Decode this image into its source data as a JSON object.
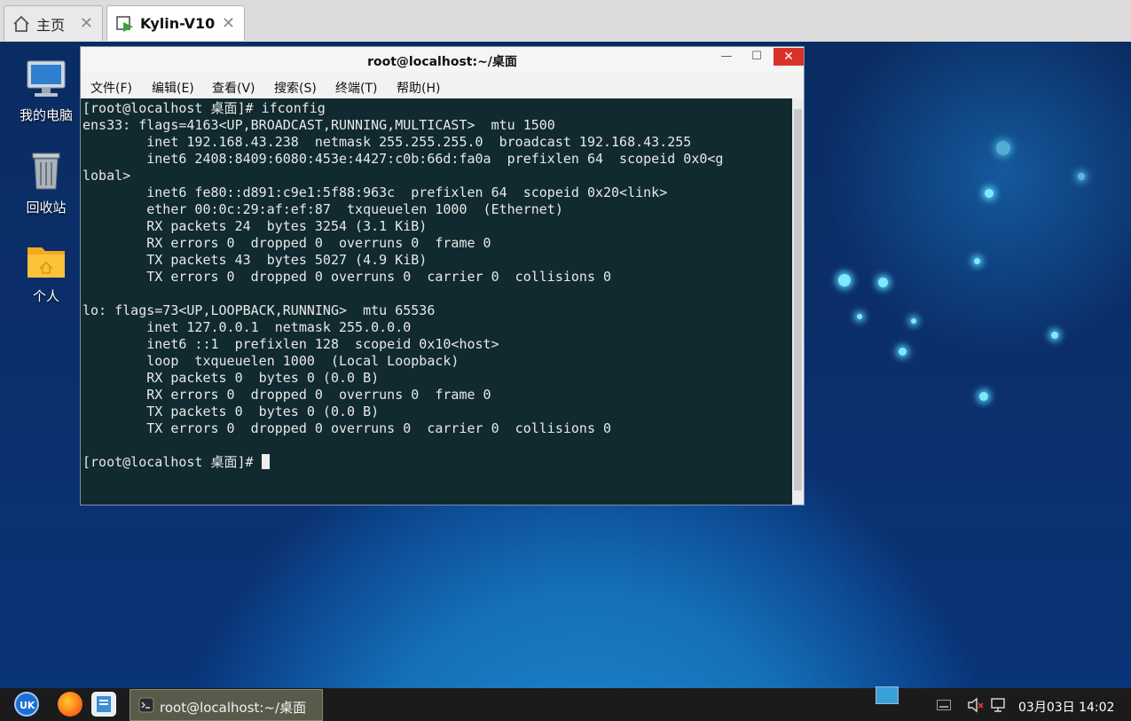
{
  "vm_tabs": [
    {
      "label": "主页",
      "icon": "home-icon"
    },
    {
      "label": "Kylin-V10",
      "icon": "vm-icon",
      "active": true
    }
  ],
  "desktop_icons": [
    {
      "label": "我的电脑",
      "icon": "computer-icon"
    },
    {
      "label": "回收站",
      "icon": "trash-icon"
    },
    {
      "label": "个人",
      "icon": "home-folder-icon"
    }
  ],
  "terminal": {
    "title": "root@localhost:~/桌面",
    "menu": [
      "文件(F)",
      "编辑(E)",
      "查看(V)",
      "搜索(S)",
      "终端(T)",
      "帮助(H)"
    ],
    "lines": [
      "[root@localhost 桌面]# ifconfig",
      "ens33: flags=4163<UP,BROADCAST,RUNNING,MULTICAST>  mtu 1500",
      "        inet 192.168.43.238  netmask 255.255.255.0  broadcast 192.168.43.255",
      "        inet6 2408:8409:6080:453e:4427:c0b:66d:fa0a  prefixlen 64  scopeid 0x0<g",
      "lobal>",
      "        inet6 fe80::d891:c9e1:5f88:963c  prefixlen 64  scopeid 0x20<link>",
      "        ether 00:0c:29:af:ef:87  txqueuelen 1000  (Ethernet)",
      "        RX packets 24  bytes 3254 (3.1 KiB)",
      "        RX errors 0  dropped 0  overruns 0  frame 0",
      "        TX packets 43  bytes 5027 (4.9 KiB)",
      "        TX errors 0  dropped 0 overruns 0  carrier 0  collisions 0",
      "",
      "lo: flags=73<UP,LOOPBACK,RUNNING>  mtu 65536",
      "        inet 127.0.0.1  netmask 255.0.0.0",
      "        inet6 ::1  prefixlen 128  scopeid 0x10<host>",
      "        loop  txqueuelen 1000  (Local Loopback)",
      "        RX packets 0  bytes 0 (0.0 B)",
      "        RX errors 0  dropped 0  overruns 0  frame 0",
      "        TX packets 0  bytes 0 (0.0 B)",
      "        TX errors 0  dropped 0 overruns 0  carrier 0  collisions 0",
      "",
      "[root@localhost 桌面]# "
    ],
    "background_color": "#112a2f",
    "text_color": "#e8e8e8"
  },
  "taskbar": {
    "task_label": "root@localhost:~/桌面",
    "clock": "03月03日 14:02",
    "icons": [
      "kylin-start-icon",
      "firefox-icon",
      "file-manager-icon",
      "show-desktop-icon",
      "keyboard-icon",
      "volume-muted-icon",
      "network-icon"
    ]
  },
  "colors": {
    "accent": "#d9322b",
    "desktop": "#0b2f6c"
  }
}
